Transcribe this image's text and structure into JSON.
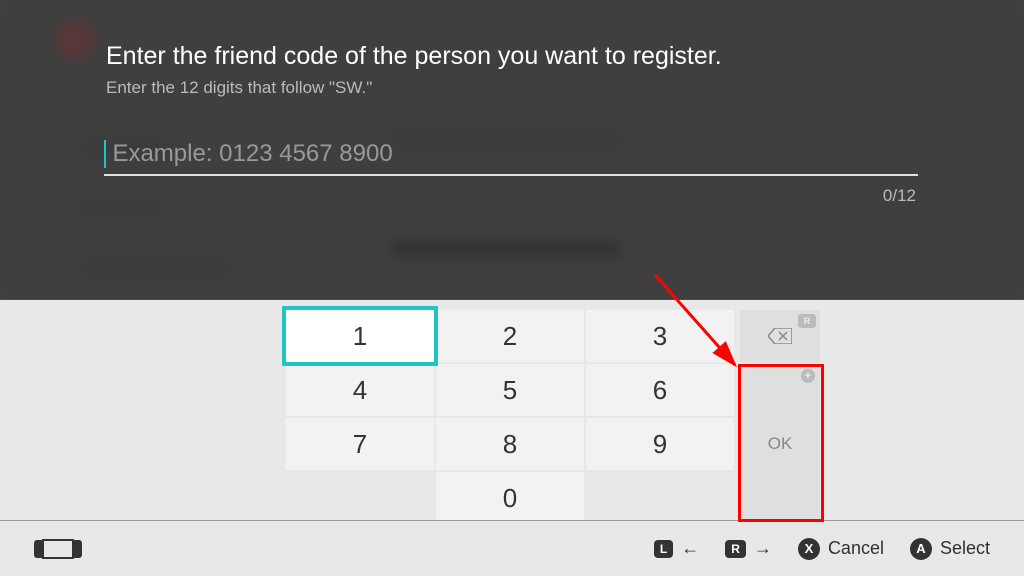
{
  "title": "Enter the friend code of the person you want to register.",
  "subtitle": "Enter the 12 digits that follow \"SW.\"",
  "input": {
    "placeholder": "Example: 0123 4567 8900",
    "value": "",
    "counter": "0/12"
  },
  "keypad": {
    "r1": [
      "1",
      "2",
      "3"
    ],
    "r2": [
      "4",
      "5",
      "6"
    ],
    "r3": [
      "7",
      "8",
      "9"
    ],
    "zero": "0",
    "ok": "OK",
    "selected": "1",
    "shoulder_r": "R",
    "plus": "+"
  },
  "footer": {
    "l_btn": "L",
    "l_arrow": "←",
    "r_btn": "R",
    "r_arrow": "→",
    "x_btn": "X",
    "cancel": "Cancel",
    "a_btn": "A",
    "select": "Select"
  }
}
